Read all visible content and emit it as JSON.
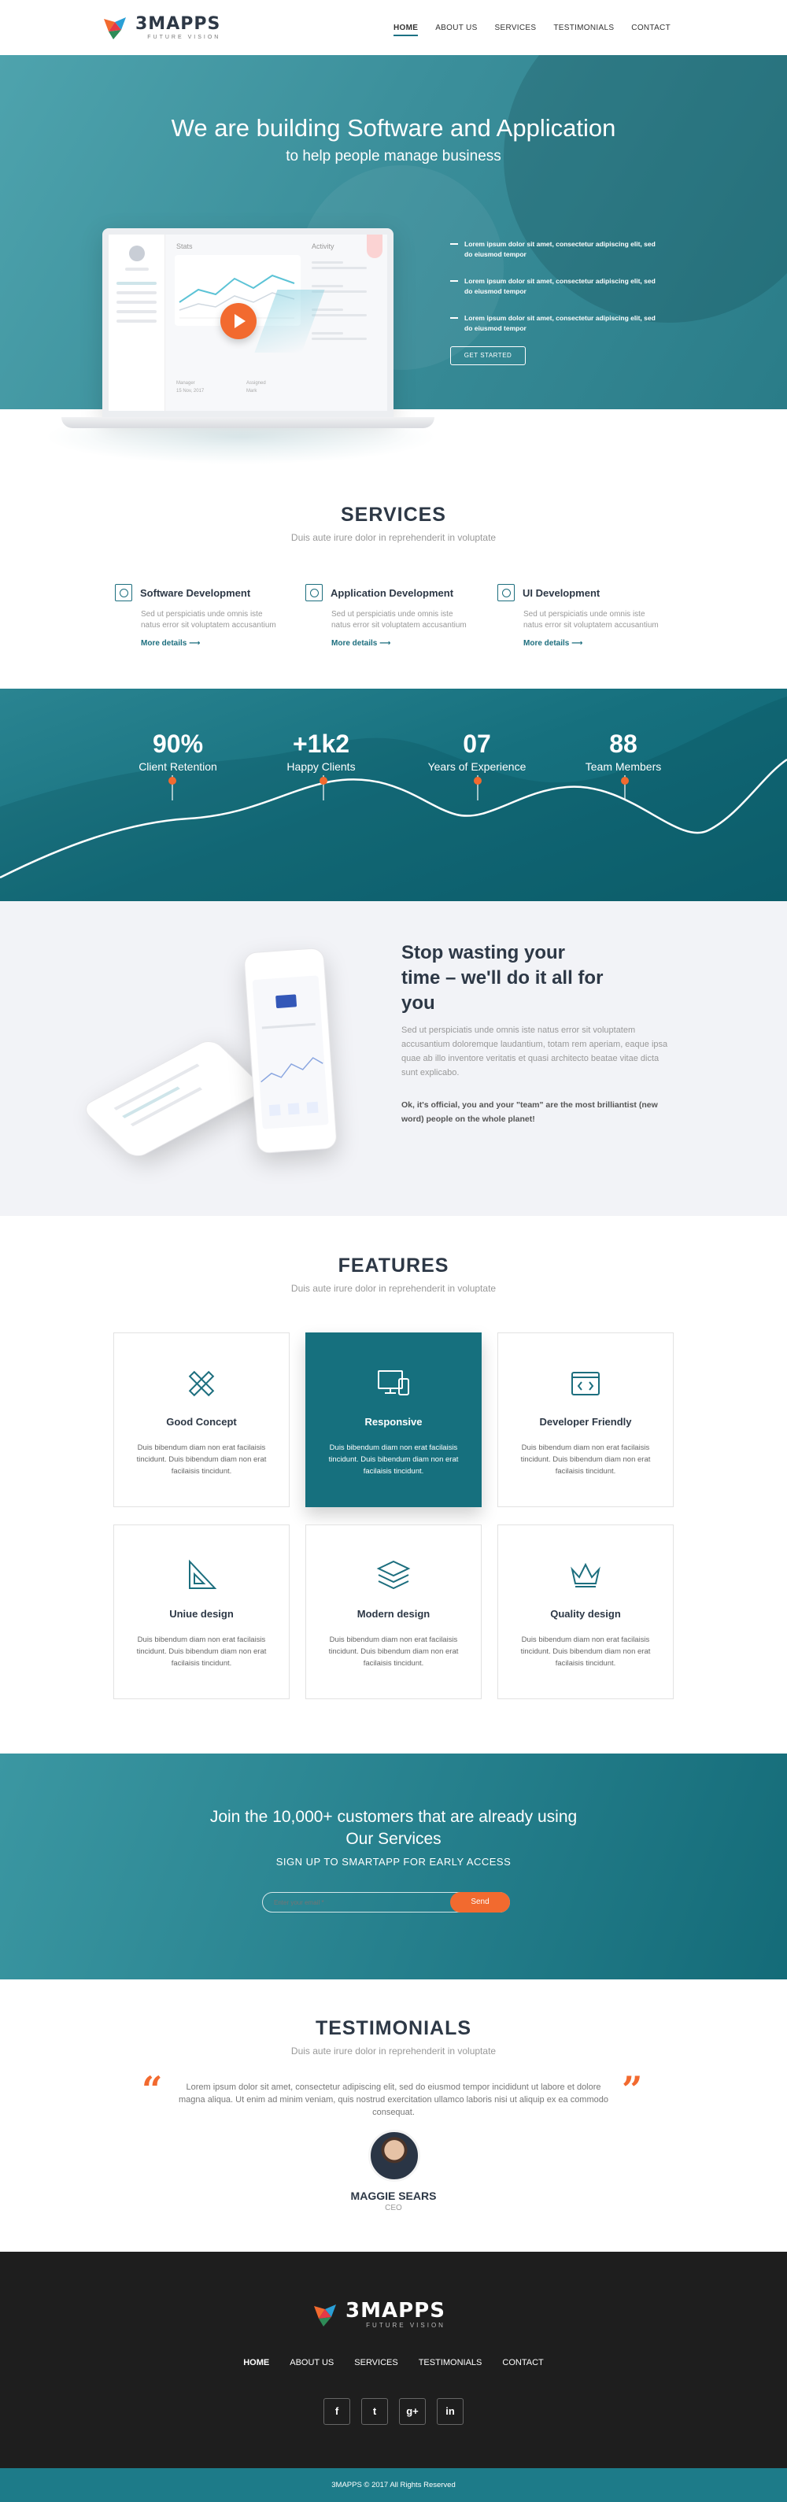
{
  "brand": {
    "name": "3MAPPS",
    "tagline": "FUTURE VISION",
    "primary_color": "#16707e",
    "accent_color": "#f26a2f"
  },
  "nav": {
    "items": [
      "HOME",
      "ABOUT US",
      "SERVICES",
      "TESTIMONIALS",
      "CONTACT"
    ],
    "active": "HOME"
  },
  "hero": {
    "title": "We are building Software and Application",
    "subtitle": "to help people manage business",
    "bullets": [
      "Lorem ipsum dolor sit amet, consectetur adipiscing elit, sed do eiusmod tempor",
      "Lorem ipsum dolor sit amet, consectetur adipiscing elit, sed do eiusmod tempor",
      "Lorem ipsum dolor sit amet, consectetur adipiscing elit, sed do eiusmod tempor"
    ],
    "cta": "GET STARTED",
    "dashboard": {
      "stats_label": "Stats",
      "activity_label": "Activity",
      "foot_left_label": "Manager",
      "foot_left_value": "15 Nov, 2017",
      "foot_right_label": "Assigned",
      "foot_right_value": "Mark"
    }
  },
  "services": {
    "title": "SERVICES",
    "subtitle": "Duis aute irure dolor in reprehenderit in voluptate",
    "items": [
      {
        "icon": "software-icon",
        "title": "Software Development",
        "text": "Sed ut perspiciatis unde omnis iste natus error sit voluptatem accusantium",
        "link": "More details"
      },
      {
        "icon": "apps-grid-icon",
        "title": "Application Development",
        "text": "Sed ut perspiciatis unde omnis iste natus error sit voluptatem accusantium",
        "link": "More details"
      },
      {
        "icon": "ui-design-icon",
        "title": "UI Development",
        "text": "Sed ut perspiciatis unde omnis iste natus error sit voluptatem accusantium",
        "link": "More details"
      }
    ]
  },
  "stats": [
    {
      "value": "90%",
      "label": "Client Retention"
    },
    {
      "value": "+1k2",
      "label": "Happy Clients"
    },
    {
      "value": "07",
      "label": "Years of Experience"
    },
    {
      "value": "88",
      "label": "Team Members"
    }
  ],
  "promo": {
    "title": "Stop wasting your time – we'll do it all for you",
    "body": "Sed ut perspiciatis unde omnis iste natus error sit voluptatem accusantium doloremque laudantium, totam rem aperiam, eaque ipsa quae ab illo inventore veritatis et quasi architecto beatae vitae dicta sunt explicabo.",
    "bold": "Ok, it's official, you and your \"team\" are the most brilliantist (new word) people on the whole planet!"
  },
  "features": {
    "title": "FEATURES",
    "subtitle": "Duis aute irure dolor in reprehenderit in voluptate",
    "items": [
      {
        "icon": "pencil-ruler-icon",
        "title": "Good Concept",
        "text": "Duis bibendum diam non erat facilaisis tincidunt. Duis bibendum diam non erat facilaisis tincidunt."
      },
      {
        "icon": "devices-icon",
        "title": "Responsive",
        "text": "Duis bibendum diam non erat facilaisis tincidunt. Duis bibendum diam non erat facilaisis tincidunt."
      },
      {
        "icon": "code-window-icon",
        "title": "Developer Friendly",
        "text": "Duis bibendum diam non erat facilaisis tincidunt. Duis bibendum diam non erat facilaisis tincidunt."
      },
      {
        "icon": "set-square-icon",
        "title": "Uniue design",
        "text": "Duis bibendum diam non erat facilaisis tincidunt. Duis bibendum diam non erat facilaisis tincidunt."
      },
      {
        "icon": "layers-icon",
        "title": "Modern design",
        "text": "Duis bibendum diam non erat facilaisis tincidunt. Duis bibendum diam non erat facilaisis tincidunt."
      },
      {
        "icon": "crown-icon",
        "title": "Quality design",
        "text": "Duis bibendum diam non erat facilaisis tincidunt. Duis bibendum diam non erat facilaisis tincidunt."
      }
    ]
  },
  "subscribe": {
    "title_line1": "Join the 10,000+ customers that are already using",
    "title_line2": "Our Services",
    "small": "SIGN UP TO SMARTAPP FOR EARLY ACCESS",
    "placeholder": "Enter your email *",
    "button": "Send"
  },
  "testimonials": {
    "title": "TESTIMONIALS",
    "subtitle": "Duis aute irure dolor in reprehenderit in voluptate",
    "quote": "Lorem ipsum dolor sit amet, consectetur adipiscing elit, sed do eiusmod tempor incididunt ut labore et dolore magna aliqua. Ut enim ad minim veniam, quis nostrud exercitation ullamco laboris nisi ut aliquip ex ea commodo consequat.",
    "name": "MAGGIE SEARS",
    "role": "CEO"
  },
  "footer": {
    "menu": [
      "HOME",
      "ABOUT US",
      "SERVICES",
      "TESTIMONIALS",
      "CONTACT"
    ],
    "social": [
      {
        "icon": "facebook-icon",
        "glyph": "f"
      },
      {
        "icon": "twitter-icon",
        "glyph": "t"
      },
      {
        "icon": "google-plus-icon",
        "glyph": "g+"
      },
      {
        "icon": "linkedin-icon",
        "glyph": "in"
      }
    ],
    "copyright": "3MAPPS © 2017 All Rights Reserved"
  }
}
